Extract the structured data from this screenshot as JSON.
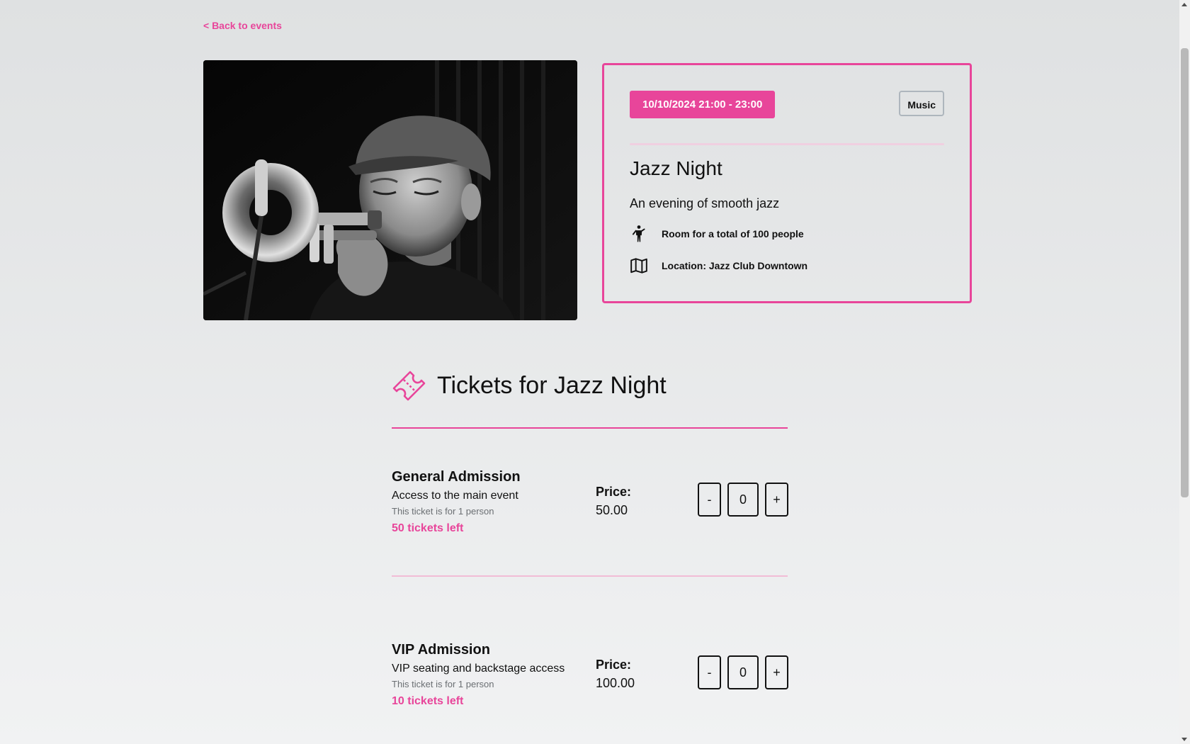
{
  "nav": {
    "back_label": "< Back to events"
  },
  "event": {
    "date_time": "10/10/2024 21:00 - 23:00",
    "category": "Music",
    "title": "Jazz Night",
    "description": "An evening of smooth jazz",
    "capacity_text": "Room for a total of 100 people",
    "location_text": "Location: Jazz Club Downtown",
    "image_icon": "trumpet-player-photo"
  },
  "tickets": {
    "heading": "Tickets for Jazz Night",
    "items": [
      {
        "name": "General Admission",
        "description": "Access to the main event",
        "note": "This ticket is for 1 person",
        "left_text": "50 tickets left",
        "price_label": "Price:",
        "price": "50.00",
        "quantity": "0",
        "minus": "-",
        "plus": "+"
      },
      {
        "name": "VIP Admission",
        "description": "VIP seating and backstage access",
        "note": "This ticket is for 1 person",
        "left_text": "10 tickets left",
        "price_label": "Price:",
        "price": "100.00",
        "quantity": "0",
        "minus": "-",
        "plus": "+"
      }
    ]
  },
  "colors": {
    "accent": "#e8459a",
    "divider_light": "#f2bcd6",
    "badge_border": "#aeb6bd"
  }
}
